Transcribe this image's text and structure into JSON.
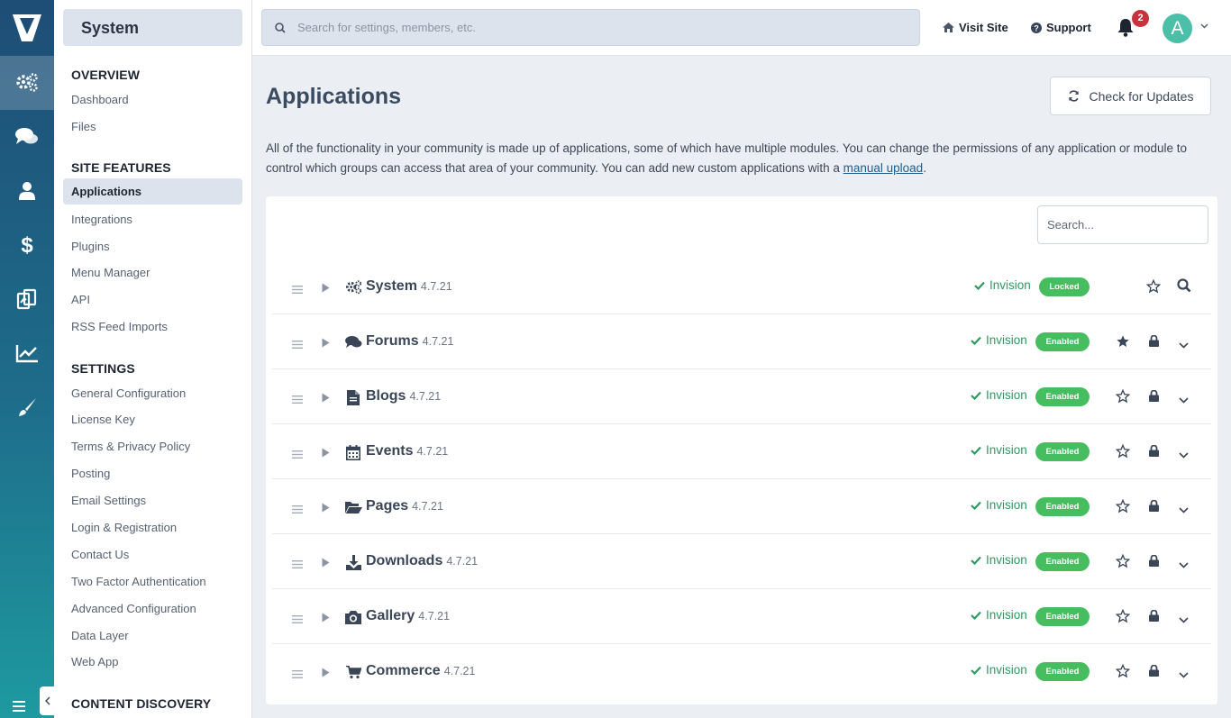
{
  "sidebar": {
    "title": "System",
    "sections": [
      {
        "heading": "OVERVIEW",
        "items": [
          "Dashboard",
          "Files"
        ]
      },
      {
        "heading": "SITE FEATURES",
        "items": [
          "Applications",
          "Integrations",
          "Plugins",
          "Menu Manager",
          "API",
          "RSS Feed Imports"
        ]
      },
      {
        "heading": "SETTINGS",
        "items": [
          "General Configuration",
          "License Key",
          "Terms & Privacy Policy",
          "Posting",
          "Email Settings",
          "Login & Registration",
          "Contact Us",
          "Two Factor Authentication",
          "Advanced Configuration",
          "Data Layer",
          "Web App"
        ]
      },
      {
        "heading": "CONTENT DISCOVERY",
        "items": []
      }
    ],
    "active_item": "Applications"
  },
  "rail": {
    "items": [
      "system-icon",
      "comments-icon",
      "members-icon",
      "commerce-icon",
      "content-icon",
      "stats-icon",
      "customization-icon"
    ],
    "active": "system-icon"
  },
  "topbar": {
    "search_placeholder": "Search for settings, members, etc.",
    "visit_site": "Visit Site",
    "support": "Support",
    "notification_count": "2",
    "avatar_letter": "A"
  },
  "main": {
    "title": "Applications",
    "check_updates": "Check for Updates",
    "description_text": "All of the functionality in your community is made up of applications, some of which have multiple modules. You can change the permissions of any application or module to control which groups can access that area of your community. You can add new custom applications with a ",
    "description_link": "manual upload",
    "description_end": ".",
    "panel_search_placeholder": "Search..."
  },
  "apps": [
    {
      "name": "System",
      "version": "4.7.21",
      "author": "Invision",
      "status": "Locked",
      "icon": "cogs-icon",
      "favorited": false
    },
    {
      "name": "Forums",
      "version": "4.7.21",
      "author": "Invision",
      "status": "Enabled",
      "icon": "comments-icon",
      "favorited": true
    },
    {
      "name": "Blogs",
      "version": "4.7.21",
      "author": "Invision",
      "status": "Enabled",
      "icon": "document-icon",
      "favorited": false
    },
    {
      "name": "Events",
      "version": "4.7.21",
      "author": "Invision",
      "status": "Enabled",
      "icon": "calendar-icon",
      "favorited": false
    },
    {
      "name": "Pages",
      "version": "4.7.21",
      "author": "Invision",
      "status": "Enabled",
      "icon": "folder-open-icon",
      "favorited": false
    },
    {
      "name": "Downloads",
      "version": "4.7.21",
      "author": "Invision",
      "status": "Enabled",
      "icon": "download-icon",
      "favorited": false
    },
    {
      "name": "Gallery",
      "version": "4.7.21",
      "author": "Invision",
      "status": "Enabled",
      "icon": "camera-icon",
      "favorited": false
    },
    {
      "name": "Commerce",
      "version": "4.7.21",
      "author": "Invision",
      "status": "Enabled",
      "icon": "cart-icon",
      "favorited": false
    }
  ],
  "colors": {
    "accent": "#1e4d76",
    "enabled_badge": "#46bd5e",
    "author_green": "#2e9a62",
    "notification_badge": "#c7323d",
    "avatar": "#4bbfa7"
  }
}
